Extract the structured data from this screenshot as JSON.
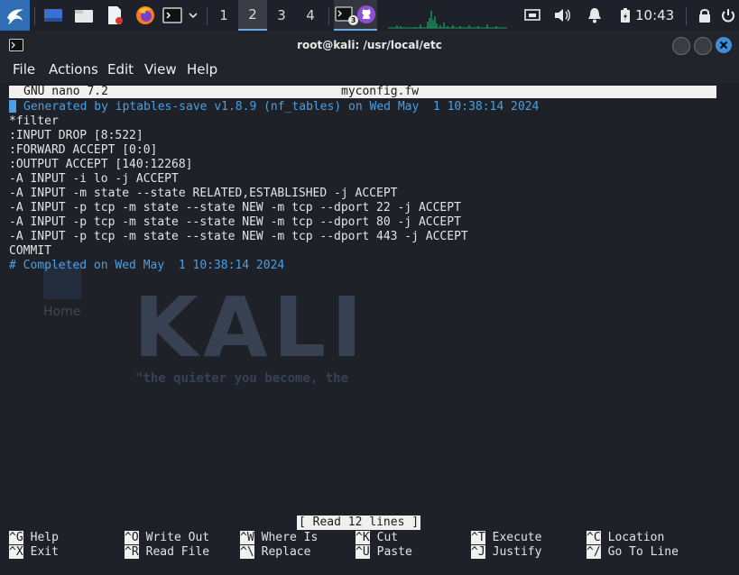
{
  "panel": {
    "workspaces": [
      "1",
      "2",
      "3",
      "4"
    ],
    "active_workspace": "2",
    "clock": "10:43",
    "badge_count": "3"
  },
  "window": {
    "title": "root@kali: /usr/local/etc",
    "menu": [
      "File",
      "Actions",
      "Edit",
      "View",
      "Help"
    ]
  },
  "nano": {
    "version": "GNU nano 7.2",
    "filename": "myconfig.fw",
    "lines": [
      {
        "text": "Generated by iptables-save v1.8.9 (nf_tables) on Wed May  1 10:38:14 2024",
        "comment": true
      },
      {
        "text": "*filter",
        "comment": false
      },
      {
        "text": ":INPUT DROP [8:522]",
        "comment": false
      },
      {
        "text": ":FORWARD ACCEPT [0:0]",
        "comment": false
      },
      {
        "text": ":OUTPUT ACCEPT [140:12268]",
        "comment": false
      },
      {
        "text": "-A INPUT -i lo -j ACCEPT",
        "comment": false
      },
      {
        "text": "-A INPUT -m state --state RELATED,ESTABLISHED -j ACCEPT",
        "comment": false
      },
      {
        "text": "-A INPUT -p tcp -m state --state NEW -m tcp --dport 22 -j ACCEPT",
        "comment": false
      },
      {
        "text": "-A INPUT -p tcp -m state --state NEW -m tcp --dport 80 -j ACCEPT",
        "comment": false
      },
      {
        "text": "-A INPUT -p tcp -m state --state NEW -m tcp --dport 443 -j ACCEPT",
        "comment": false
      },
      {
        "text": "COMMIT",
        "comment": false
      },
      {
        "text": "# Completed on Wed May  1 10:38:14 2024",
        "comment": true
      }
    ],
    "status": "[ Read 12 lines ]",
    "shortcuts": [
      {
        "key": "^G",
        "label": "Help"
      },
      {
        "key": "^O",
        "label": "Write Out"
      },
      {
        "key": "^W",
        "label": "Where Is"
      },
      {
        "key": "^K",
        "label": "Cut"
      },
      {
        "key": "^T",
        "label": "Execute"
      },
      {
        "key": "^C",
        "label": "Location"
      },
      {
        "key": "^X",
        "label": "Exit"
      },
      {
        "key": "^R",
        "label": "Read File"
      },
      {
        "key": "^\\",
        "label": "Replace"
      },
      {
        "key": "^U",
        "label": "Paste"
      },
      {
        "key": "^J",
        "label": "Justify"
      },
      {
        "key": "^/",
        "label": "Go To Line"
      }
    ]
  },
  "wallpaper": {
    "logo_text": "KALI",
    "tagline": "\"the quieter you become, the",
    "home_label": "Home"
  },
  "colors": {
    "panel_bg": "#1e2129",
    "accent": "#2f6db5",
    "comment": "#4c9fe0",
    "terminal_bg": "#1e2128",
    "close_button": "#3b8fd9"
  }
}
